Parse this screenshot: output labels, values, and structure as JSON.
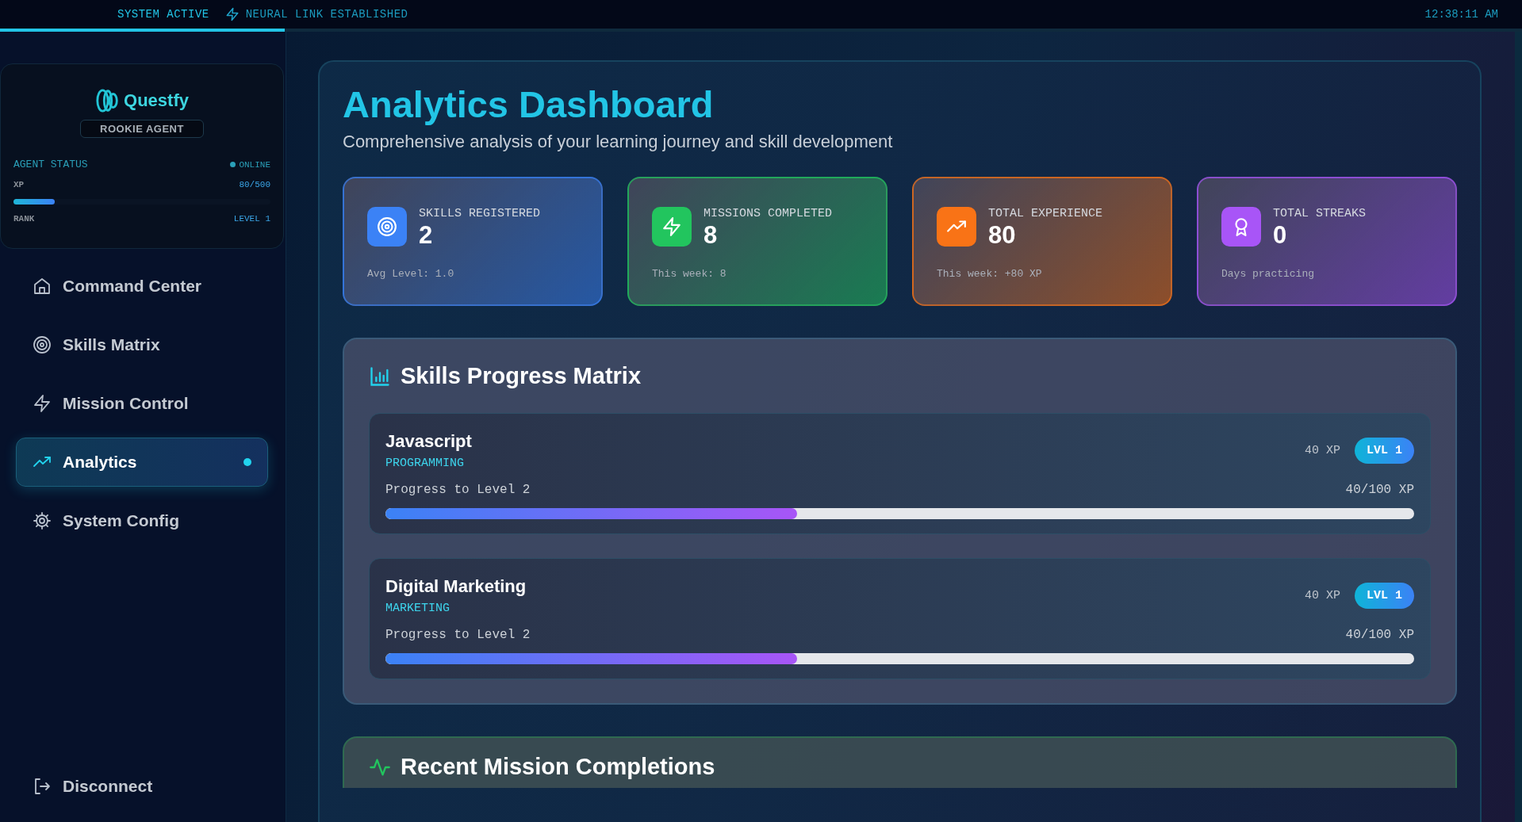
{
  "status_bar": {
    "items": [
      "SYSTEM ACTIVE",
      "NEURAL LINK ESTABLISHED"
    ],
    "time": "12:38:11 AM"
  },
  "sidebar": {
    "brand": "Questfy",
    "badge": "ROOKIE AGENT",
    "status": {
      "title": "AGENT STATUS",
      "state": "ONLINE",
      "xp_label": "XP",
      "xp_value": "80/500",
      "level": 0.16,
      "rank_label": "RANK",
      "rank_value": "LEVEL 1"
    },
    "items": [
      {
        "label": "Command Center",
        "selected": false
      },
      {
        "label": "Skills Matrix",
        "selected": false
      },
      {
        "label": "Mission Control",
        "selected": false
      },
      {
        "label": "Analytics",
        "selected": true
      },
      {
        "label": "System Config",
        "selected": false
      }
    ],
    "footer": "Disconnect"
  },
  "header": {
    "title": "Analytics Dashboard",
    "subtitle": "Comprehensive analysis of your learning journey and skill development"
  },
  "stats": [
    {
      "label": "SKILLS REGISTERED",
      "value": "2",
      "note": "Avg Level: 1.0",
      "color": "#3b82f6"
    },
    {
      "label": "MISSIONS COMPLETED",
      "value": "8",
      "note": "This week: 8",
      "color": "#22c55e"
    },
    {
      "label": "TOTAL EXPERIENCE",
      "value": "80",
      "note": "This week: +80 XP",
      "color": "#f97316"
    },
    {
      "label": "TOTAL STREAKS",
      "value": "0",
      "note": "Days practicing",
      "color": "#a855f7"
    }
  ],
  "skills_panel": {
    "title": "Skills Progress Matrix",
    "skills": [
      {
        "name": "Javascript",
        "category": "PROGRAMMING",
        "xp": "40 XP",
        "badge": "LVL 1",
        "progress_label": "Progress to Level 2",
        "progress_value": "40/100 XP",
        "level": 0.4
      },
      {
        "name": "Digital Marketing",
        "category": "MARKETING",
        "xp": "40 XP",
        "badge": "LVL 1",
        "progress_label": "Progress to Level 2",
        "progress_value": "40/100 XP",
        "level": 0.4
      }
    ]
  },
  "recent_panel": {
    "title": "Recent Mission Completions"
  }
}
